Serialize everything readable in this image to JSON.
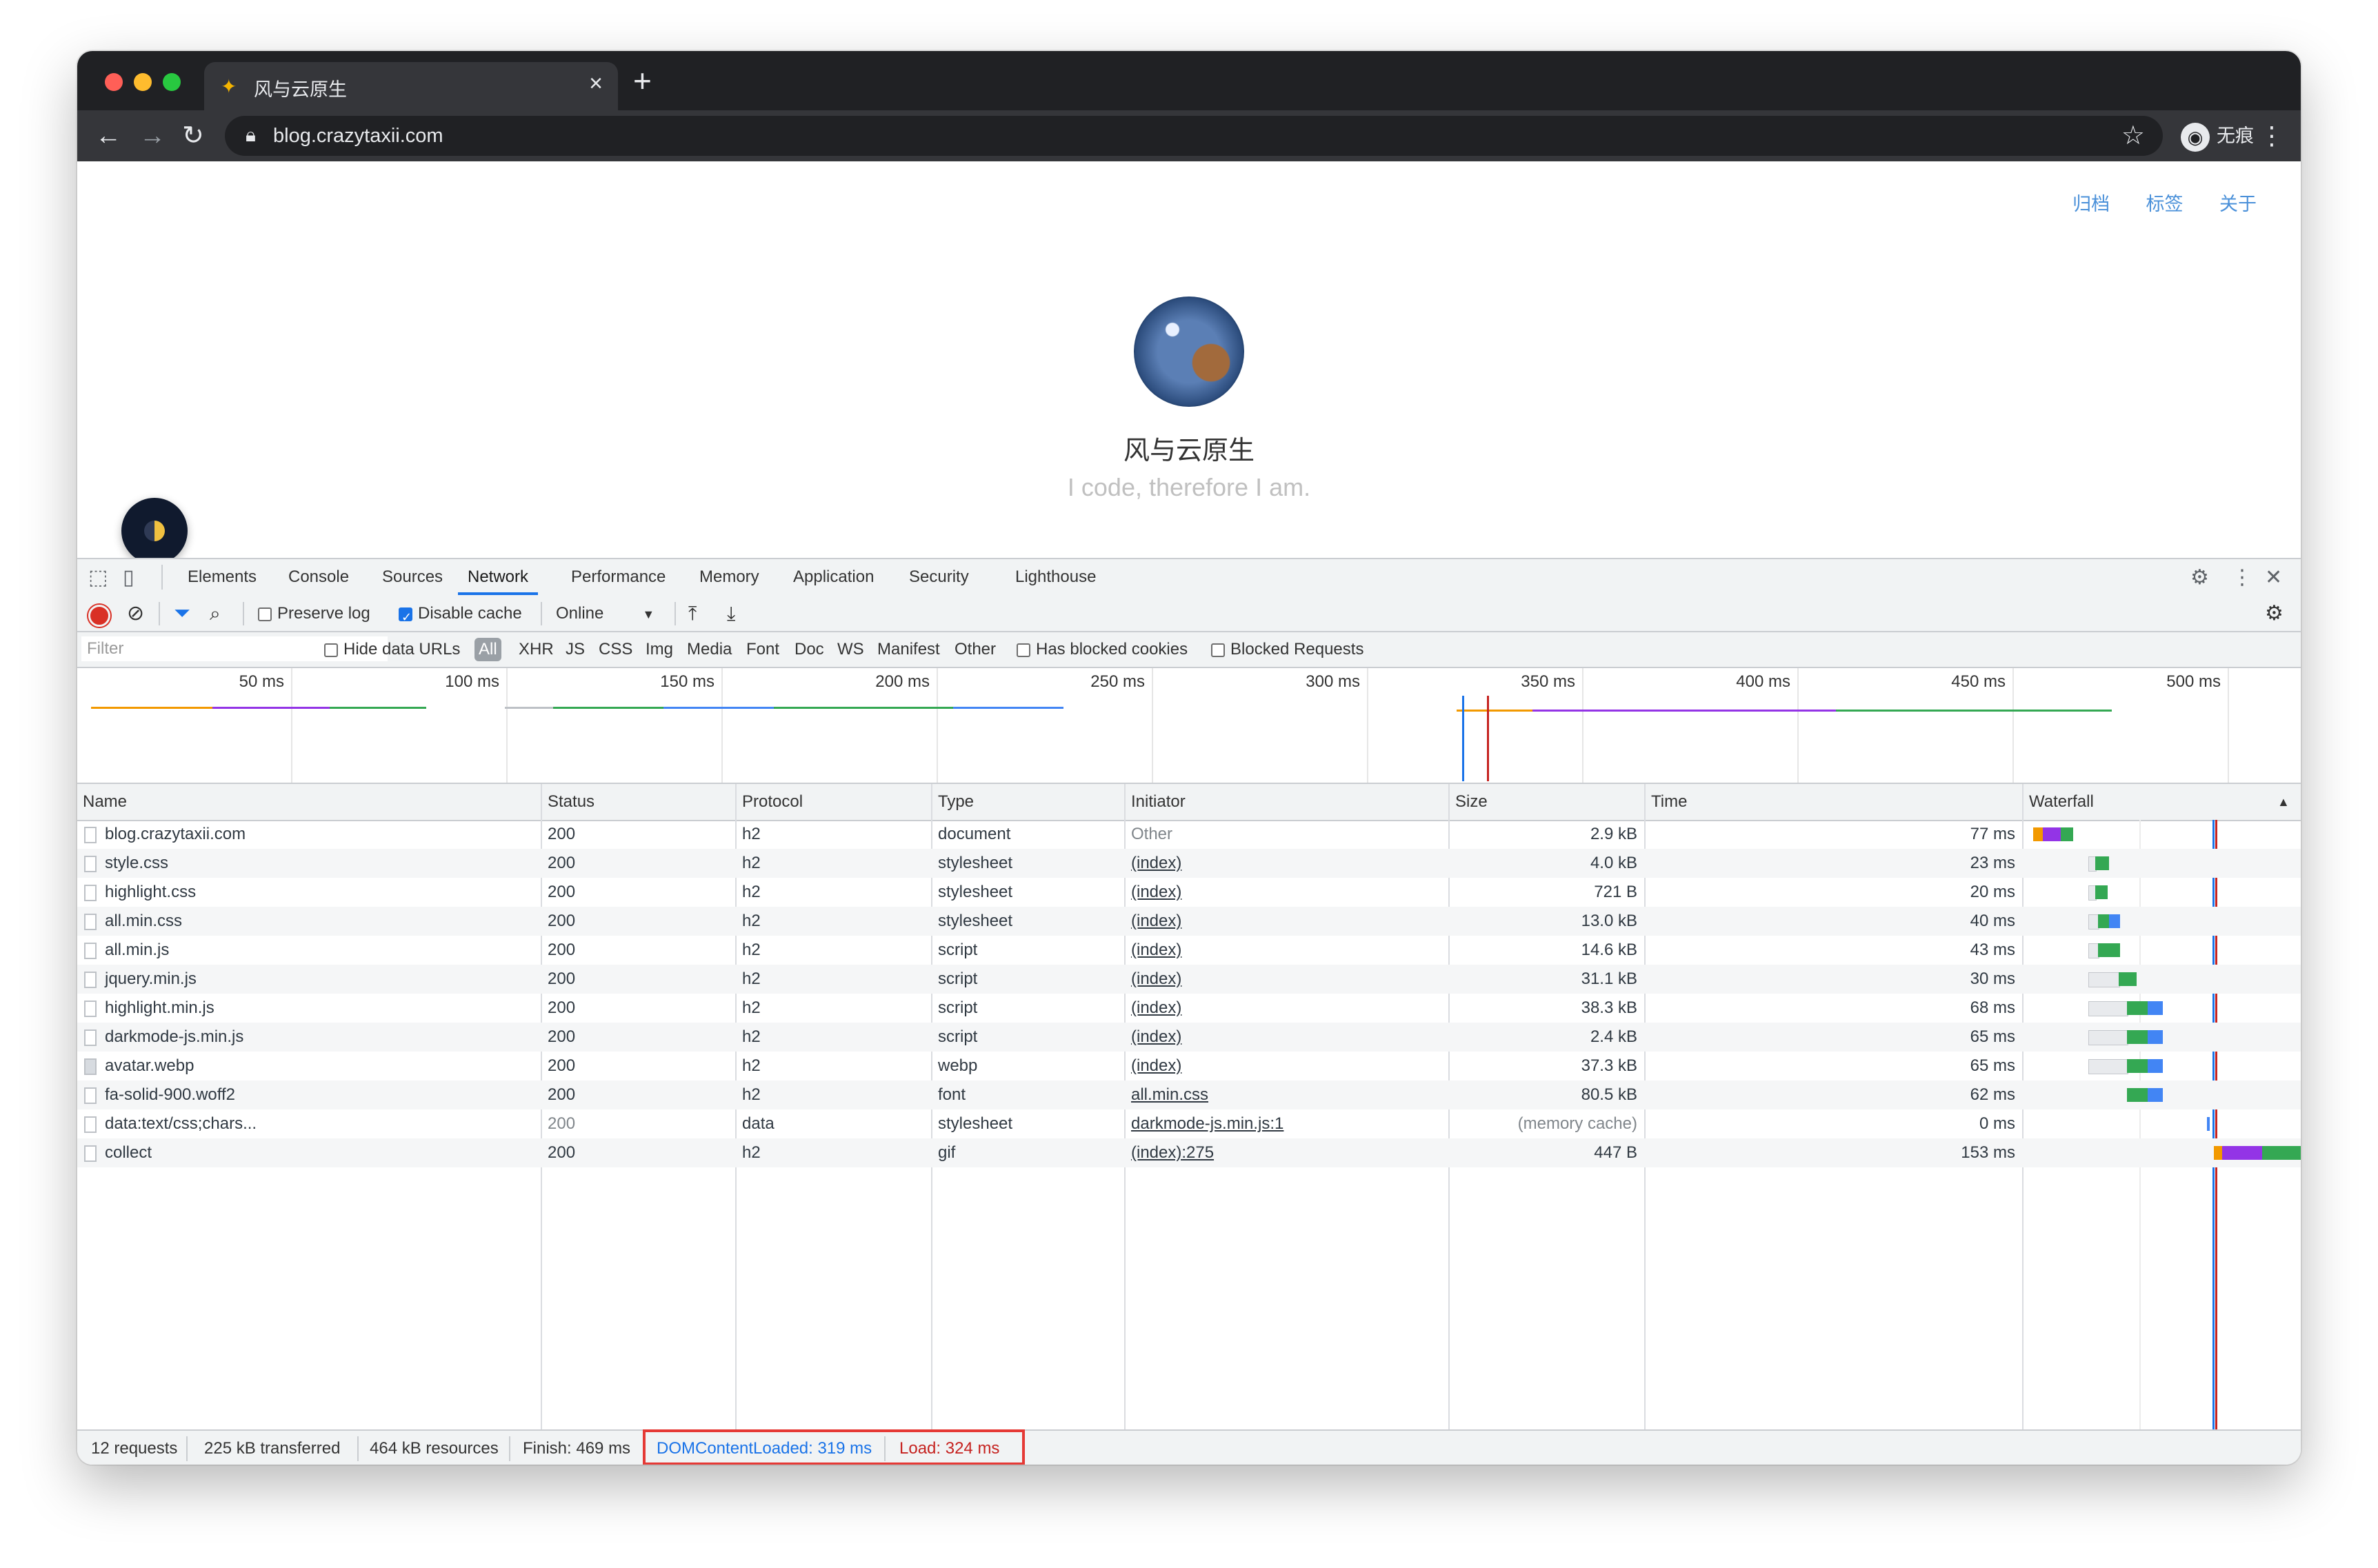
{
  "browser": {
    "tab_title": "风与云原生",
    "tab_close": "×",
    "new_tab": "+",
    "url": "blog.crazytaxii.com",
    "incognito_label": "无痕模式"
  },
  "page": {
    "nav": [
      "归档",
      "标签",
      "关于"
    ],
    "title": "风与云原生",
    "subtitle": "I code, therefore I am."
  },
  "devtools": {
    "tabs": [
      "Elements",
      "Console",
      "Sources",
      "Network",
      "Performance",
      "Memory",
      "Application",
      "Security",
      "Lighthouse"
    ],
    "active_tab": "Network",
    "toolbar": {
      "preserve_log": "Preserve log",
      "disable_cache": "Disable cache",
      "throttling": "Online"
    },
    "filterbar": {
      "filter_placeholder": "Filter",
      "hide_data_urls": "Hide data URLs",
      "types": [
        "All",
        "XHR",
        "JS",
        "CSS",
        "Img",
        "Media",
        "Font",
        "Doc",
        "WS",
        "Manifest",
        "Other"
      ],
      "has_blocked_cookies": "Has blocked cookies",
      "blocked_requests": "Blocked Requests"
    },
    "overview_ticks": [
      "50 ms",
      "100 ms",
      "150 ms",
      "200 ms",
      "250 ms",
      "300 ms",
      "350 ms",
      "400 ms",
      "450 ms",
      "500 ms"
    ],
    "columns": [
      "Name",
      "Status",
      "Protocol",
      "Type",
      "Initiator",
      "Size",
      "Time",
      "Waterfall"
    ],
    "sort_indicator": "▲",
    "requests": [
      {
        "name": "blog.crazytaxii.com",
        "status": "200",
        "protocol": "h2",
        "type": "document",
        "initiator": "Other",
        "size": "2.9 kB",
        "time": "77 ms"
      },
      {
        "name": "style.css",
        "status": "200",
        "protocol": "h2",
        "type": "stylesheet",
        "initiator": "(index)",
        "size": "4.0 kB",
        "time": "23 ms"
      },
      {
        "name": "highlight.css",
        "status": "200",
        "protocol": "h2",
        "type": "stylesheet",
        "initiator": "(index)",
        "size": "721 B",
        "time": "20 ms"
      },
      {
        "name": "all.min.css",
        "status": "200",
        "protocol": "h2",
        "type": "stylesheet",
        "initiator": "(index)",
        "size": "13.0 kB",
        "time": "40 ms"
      },
      {
        "name": "all.min.js",
        "status": "200",
        "protocol": "h2",
        "type": "script",
        "initiator": "(index)",
        "size": "14.6 kB",
        "time": "43 ms"
      },
      {
        "name": "jquery.min.js",
        "status": "200",
        "protocol": "h2",
        "type": "script",
        "initiator": "(index)",
        "size": "31.1 kB",
        "time": "30 ms"
      },
      {
        "name": "highlight.min.js",
        "status": "200",
        "protocol": "h2",
        "type": "script",
        "initiator": "(index)",
        "size": "38.3 kB",
        "time": "68 ms"
      },
      {
        "name": "darkmode-js.min.js",
        "status": "200",
        "protocol": "h2",
        "type": "script",
        "initiator": "(index)",
        "size": "2.4 kB",
        "time": "65 ms"
      },
      {
        "name": "avatar.webp",
        "status": "200",
        "protocol": "h2",
        "type": "webp",
        "initiator": "(index)",
        "size": "37.3 kB",
        "time": "65 ms"
      },
      {
        "name": "fa-solid-900.woff2",
        "status": "200",
        "protocol": "h2",
        "type": "font",
        "initiator": "all.min.css",
        "size": "80.5 kB",
        "time": "62 ms"
      },
      {
        "name": "data:text/css;chars...",
        "status": "200",
        "protocol": "data",
        "type": "stylesheet",
        "initiator": "darkmode-js.min.js:1",
        "size": "(memory cache)",
        "time": "0 ms"
      },
      {
        "name": "collect",
        "status": "200",
        "protocol": "h2",
        "type": "gif",
        "initiator": "(index):275",
        "size": "447 B",
        "time": "153 ms"
      }
    ],
    "status": {
      "requests": "12 requests",
      "transferred": "225 kB transferred",
      "resources": "464 kB resources",
      "finish": "Finish: 469 ms",
      "dom_content_loaded": "DOMContentLoaded: 319 ms",
      "load": "Load: 324 ms"
    }
  },
  "colors": {
    "dcl_blue": "#1a73e8",
    "load_red": "#c5221f",
    "accent": "#1a73e8"
  }
}
